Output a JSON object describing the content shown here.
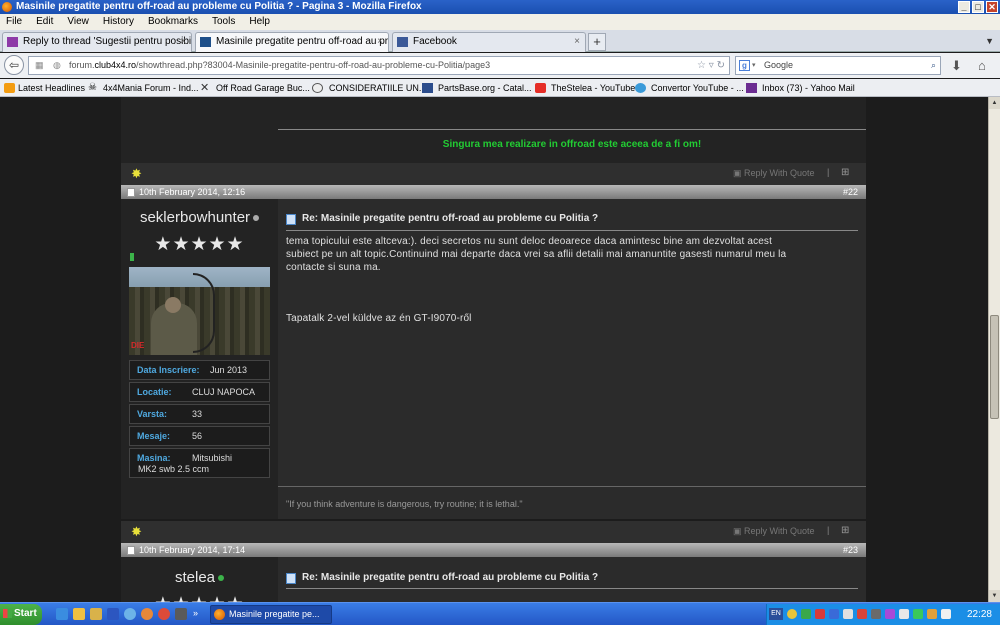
{
  "window": {
    "title": "Masinile pregatite pentru off-road au probleme cu Politia ? - Pagina 3 - Mozilla Firefox",
    "min": "_",
    "max": "□",
    "close": "✕"
  },
  "menu": [
    "File",
    "Edit",
    "View",
    "History",
    "Bookmarks",
    "Tools",
    "Help"
  ],
  "tabs": [
    {
      "label": "Reply to thread 'Sugestii pentru posibile ...",
      "icon": "mail-icon",
      "active": false
    },
    {
      "label": "Masinile pregatite pentru off-road au pro...",
      "icon": "vbulletin-icon",
      "active": true
    },
    {
      "label": "Facebook",
      "icon": "facebook-icon",
      "active": false
    }
  ],
  "tab_close": "×",
  "new_tab": "+",
  "navbar": {
    "url_prefix": "forum.",
    "url_host": "club4x4.ro",
    "url_rest": "/showthread.php?83004-Masinile-pregatite-pentru-off-road-au-probleme-cu-Politia/page3",
    "search_placeholder": "Google",
    "back": "⇦"
  },
  "bookmarks": [
    {
      "label": "Latest Headlines",
      "icon": "rss-icon"
    },
    {
      "label": "4x4Mania Forum - Ind...",
      "icon": "skull-icon"
    },
    {
      "label": "Off Road Garage Buc...",
      "icon": "tools-icon"
    },
    {
      "label": "CONSIDERATIILE UN...",
      "icon": "wordpress-icon"
    },
    {
      "label": "PartsBase.org - Catal...",
      "icon": "partsbase-icon"
    },
    {
      "label": "TheStelea - YouTube",
      "icon": "youtube-icon"
    },
    {
      "label": "Convertor YouTube - ...",
      "icon": "convertor-icon"
    },
    {
      "label": "Inbox (73) - Yahoo Mail",
      "icon": "mail-icon"
    }
  ],
  "prev_signature": "Singura mea realizare in offroad este aceea de a fi om!",
  "actions": {
    "reply_with_quote": "Reply With Quote",
    "sep": "|",
    "star": "✸",
    "multiquote": "⊞"
  },
  "posts": [
    {
      "date": "10th February 2014, 12:16",
      "number": "#22",
      "username": "seklerbowhunter",
      "online": false,
      "stars": "★★★★★",
      "info": [
        {
          "key": "Data Inscriere:",
          "value": "Jun 2013"
        },
        {
          "key": "Locatie:",
          "value": "CLUJ NAPOCA"
        },
        {
          "key": "Varsta:",
          "value": "33"
        },
        {
          "key": "Mesaje:",
          "value": "56"
        },
        {
          "key": "Masina:",
          "value": "Mitsubishi MK2 swb 2.5 ccm"
        }
      ],
      "title": "Re: Masinile pregatite pentru off-road au probleme cu Politia ?",
      "body_lines": [
        "tema topicului este altceva:). deci secretos nu sunt deloc deoarece daca amintesc bine am dezvoltat acest",
        "subiect pe un alt topic.Continuind mai departe daca vrei sa aflii detalii mai amanuntite gasesti numarul meu la",
        "contacte si suna ma."
      ],
      "tapatalk": "Tapatalk 2-vel küldve az én GT-I9070-ről",
      "signature": "\"If you think adventure is dangerous, try routine; it is lethal.\"",
      "avatar_logo": "DIE"
    },
    {
      "date": "10th February 2014, 17:14",
      "number": "#23",
      "username": "stelea",
      "online": true,
      "stars": "★★★★★",
      "title": "Re: Masinile pregatite pentru off-road au probleme cu Politia ?"
    }
  ],
  "taskbar": {
    "start": "Start",
    "window_item": "Masinile pregatite pe...",
    "lang": "EN",
    "clock": "22:28"
  },
  "scroll": {
    "up": "▲",
    "down": "▼"
  }
}
